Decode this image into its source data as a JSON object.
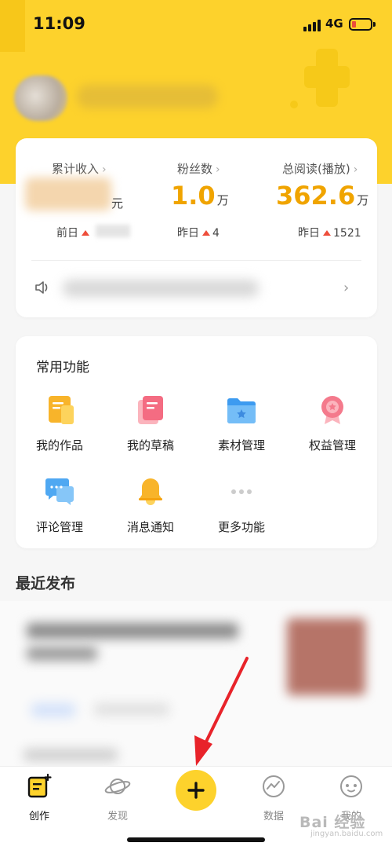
{
  "status_bar": {
    "time": "11:09",
    "network": "4G"
  },
  "stats": {
    "income": {
      "label": "累计收入",
      "unit": "元",
      "sub_label": "前日"
    },
    "fans": {
      "label": "粉丝数",
      "value": "1.0",
      "unit": "万",
      "sub_label": "昨日",
      "sub_value": "4"
    },
    "reads": {
      "label": "总阅读(播放)",
      "value": "362.6",
      "unit": "万",
      "sub_label": "昨日",
      "sub_value": "1521"
    },
    "chevron": "›"
  },
  "functions": {
    "title": "常用功能",
    "items": [
      {
        "label": "我的作品",
        "icon": "my-works-icon"
      },
      {
        "label": "我的草稿",
        "icon": "drafts-icon"
      },
      {
        "label": "素材管理",
        "icon": "material-folder-icon"
      },
      {
        "label": "权益管理",
        "icon": "rights-badge-icon"
      },
      {
        "label": "评论管理",
        "icon": "comment-icon"
      },
      {
        "label": "消息通知",
        "icon": "bell-icon"
      },
      {
        "label": "更多功能",
        "icon": "more-icon"
      }
    ]
  },
  "recent": {
    "title": "最近发布"
  },
  "tabbar": {
    "items": [
      {
        "label": "创作",
        "active": true
      },
      {
        "label": "发现",
        "active": false
      },
      {
        "label": "数据",
        "active": false
      },
      {
        "label": "我的",
        "active": false
      }
    ],
    "fab_label": "+"
  },
  "colors": {
    "brand_yellow": "#fdd22c",
    "accent_orange": "#f0a400",
    "arrow_red": "#e8232a"
  },
  "watermark": {
    "text": "Bai 经验",
    "sub": "jingyan.baidu.com"
  }
}
